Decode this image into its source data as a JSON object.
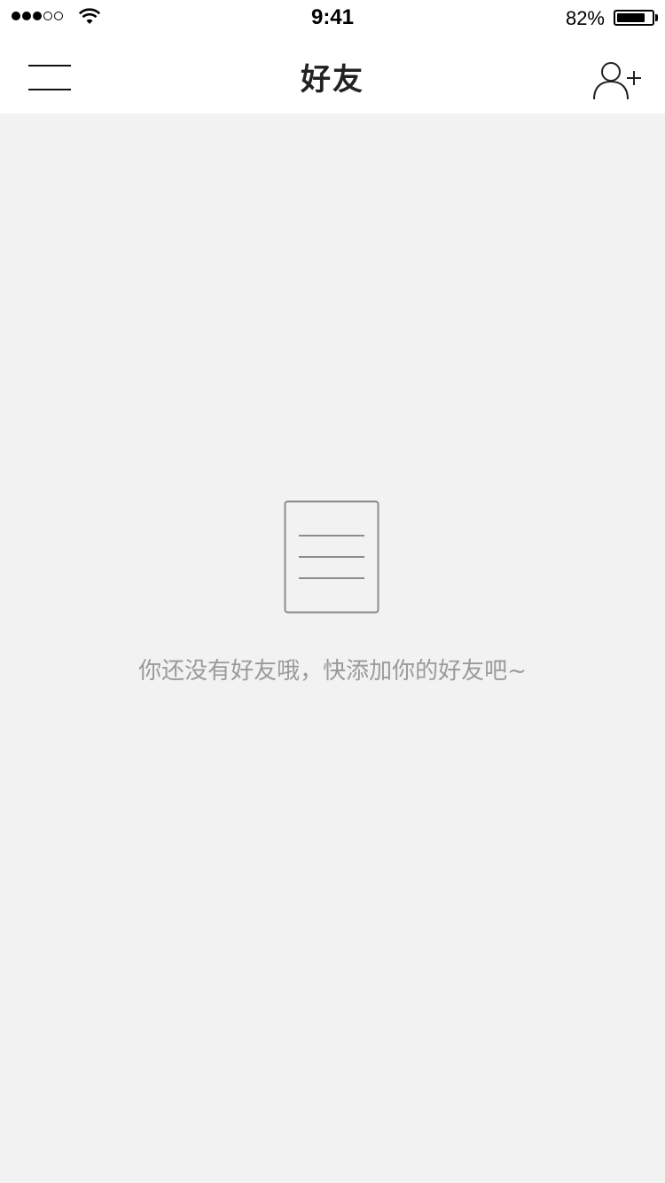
{
  "status_bar": {
    "signal_dots": {
      "filled": 3,
      "empty": 2
    },
    "wifi_icon": "wifi-icon",
    "time": "9:41",
    "battery_percent": "82%",
    "battery_level": 0.82
  },
  "nav_bar": {
    "title": "好友",
    "menu_icon": "hamburger-menu-icon",
    "add_icon": "add-user-icon"
  },
  "empty_state": {
    "icon": "document-icon",
    "message": "你还没有好友哦，快添加你的好友吧~"
  },
  "colors": {
    "background": "#f2f2f2",
    "bar_background": "#ffffff",
    "icon_gray": "#8c8c8c",
    "text_gray": "#9a9a9a"
  }
}
